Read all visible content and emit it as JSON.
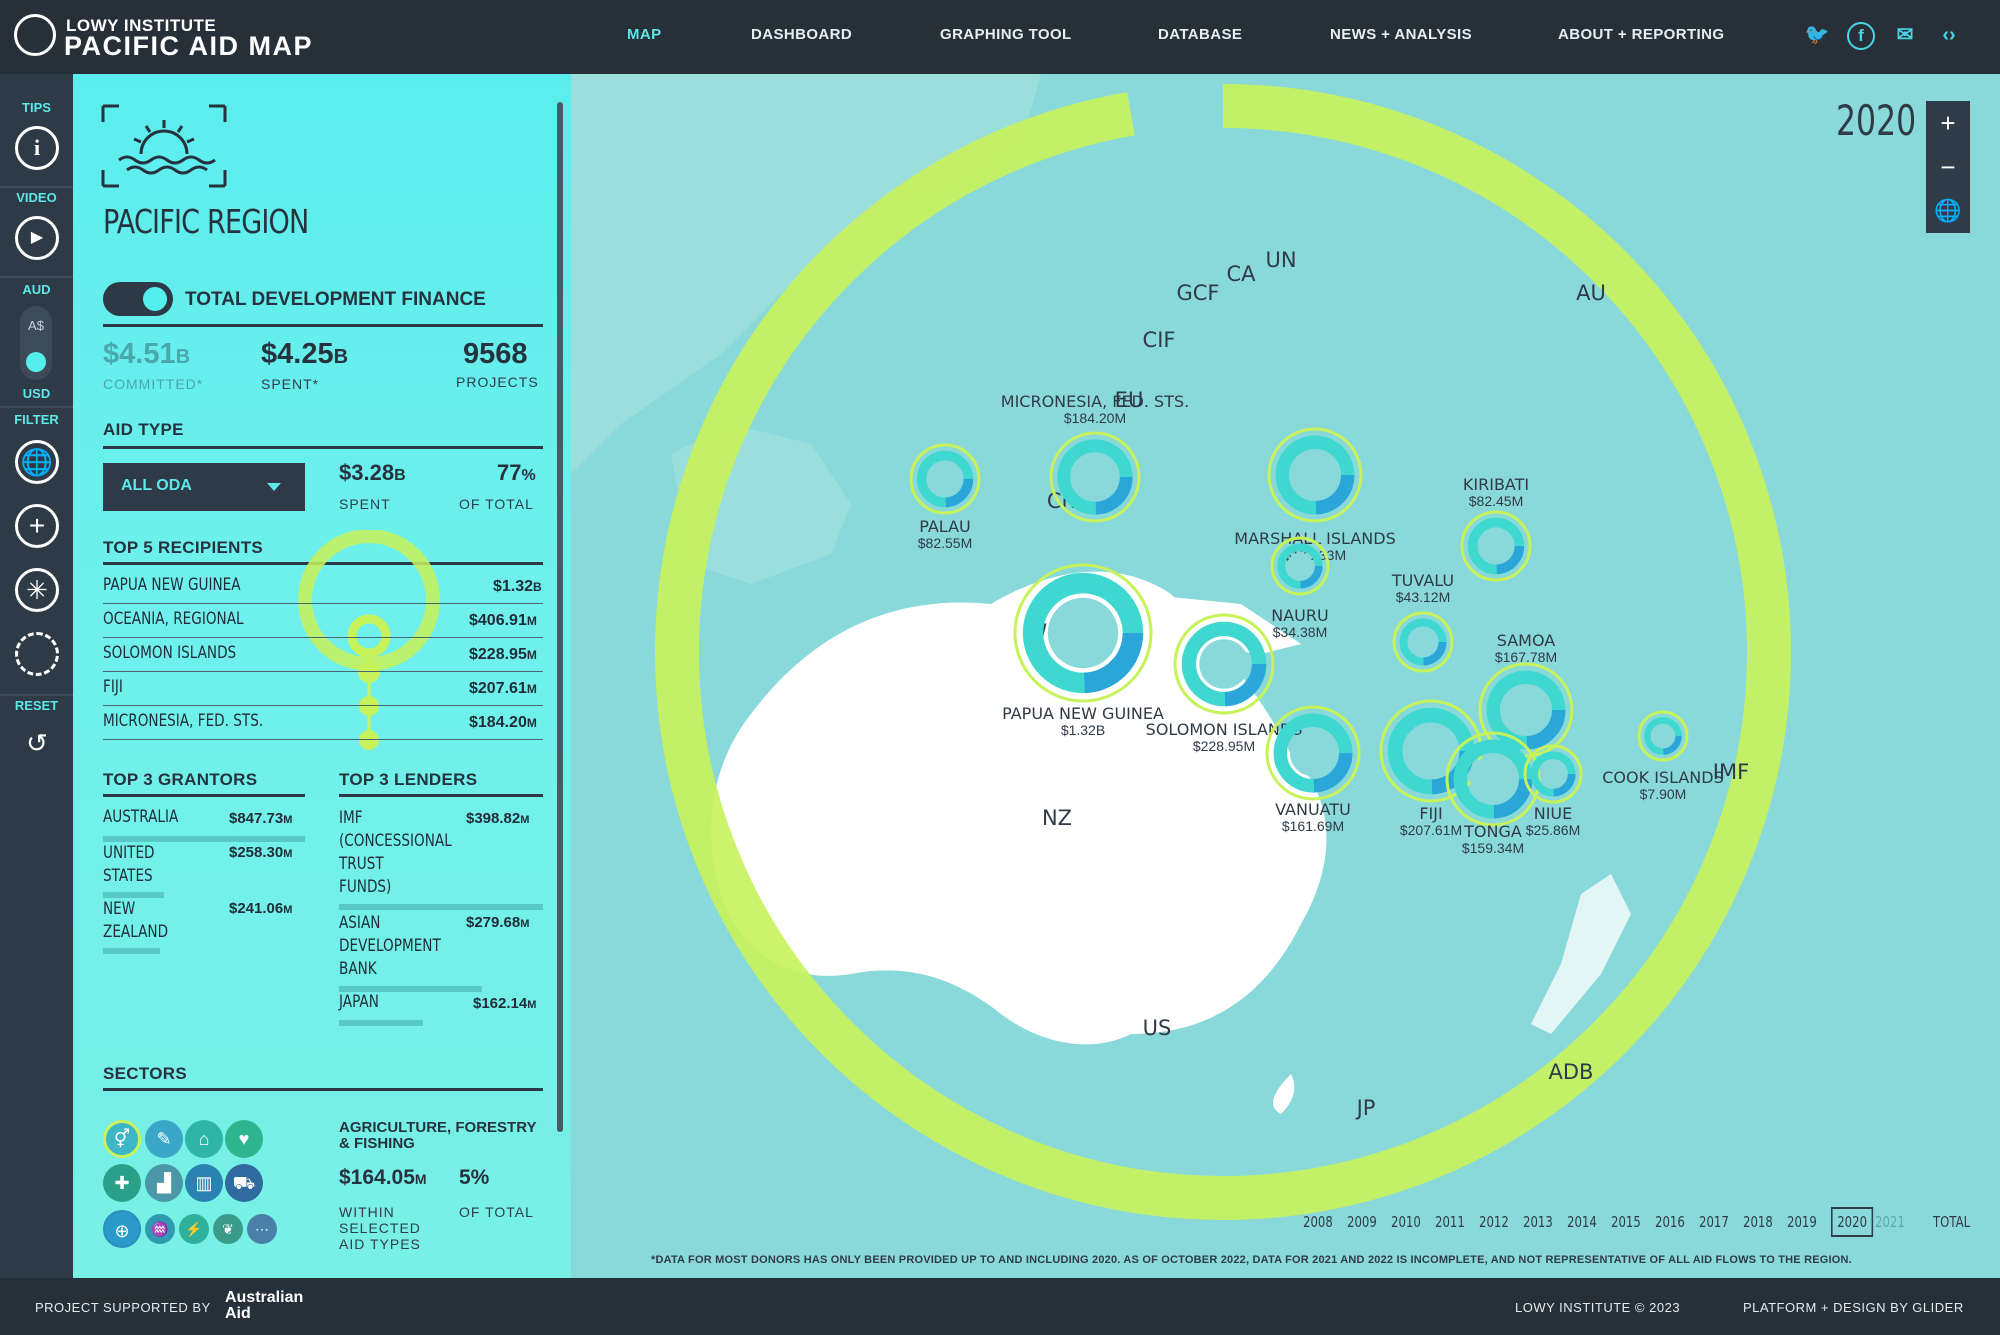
{
  "header": {
    "logo_sub": "LOWY INSTITUTE",
    "logo_title": "PACIFIC AID MAP",
    "nav": [
      "MAP",
      "DASHBOARD",
      "GRAPHING TOOL",
      "DATABASE",
      "NEWS + ANALYSIS",
      "ABOUT + REPORTING"
    ],
    "active_nav": "MAP",
    "social": [
      "twitter-icon",
      "facebook-icon",
      "mail-icon",
      "embed-code-icon"
    ]
  },
  "rail": {
    "tips": "TIPS",
    "video": "VIDEO",
    "aud": "AUD",
    "currency_symbol": "A$",
    "usd": "USD",
    "filter": "FILTER",
    "reset": "RESET"
  },
  "panel": {
    "region": "PACIFIC REGION",
    "toggle_label": "TOTAL DEVELOPMENT FINANCE",
    "committed_value": "$4.51",
    "committed_unit": "B",
    "committed_label": "COMMITTED*",
    "spent_value": "$4.25",
    "spent_unit": "B",
    "spent_label": "SPENT*",
    "projects_value": "9568",
    "projects_label": "PROJECTS",
    "aid_type_heading": "AID TYPE",
    "aid_type_selected": "ALL ODA",
    "aid_spent_value": "$3.28",
    "aid_spent_unit": "B",
    "aid_spent_label": "SPENT",
    "aid_pct_value": "77",
    "aid_pct_unit": "%",
    "aid_pct_label": "OF TOTAL",
    "top5_heading": "TOP 5 RECIPIENTS",
    "top5": [
      {
        "name": "PAPUA NEW GUINEA",
        "value": "$1.32",
        "unit": "B"
      },
      {
        "name": "OCEANIA, REGIONAL",
        "value": "$406.91",
        "unit": "M"
      },
      {
        "name": "SOLOMON ISLANDS",
        "value": "$228.95",
        "unit": "M"
      },
      {
        "name": "FIJI",
        "value": "$207.61",
        "unit": "M"
      },
      {
        "name": "MICRONESIA, FED. STS.",
        "value": "$184.20",
        "unit": "M"
      }
    ],
    "grantors_heading": "TOP 3 GRANTORS",
    "grantors": [
      {
        "name": "AUSTRALIA",
        "value": "$847.73",
        "unit": "M",
        "share": 1.0
      },
      {
        "name": "UNITED STATES",
        "value": "$258.30",
        "unit": "M",
        "share": 0.3
      },
      {
        "name": "NEW ZEALAND",
        "value": "$241.06",
        "unit": "M",
        "share": 0.28
      }
    ],
    "lenders_heading": "TOP 3 LENDERS",
    "lenders": [
      {
        "name": "IMF (CONCESSIONAL TRUST FUNDS)",
        "value": "$398.82",
        "unit": "M",
        "share": 1.0
      },
      {
        "name": "ASIAN DEVELOPMENT BANK",
        "value": "$279.68",
        "unit": "M",
        "share": 0.7
      },
      {
        "name": "JAPAN",
        "value": "$162.14",
        "unit": "M",
        "share": 0.41
      }
    ],
    "sectors_heading": "SECTORS",
    "sector_name": "AGRICULTURE, FORESTRY & FISHING",
    "sector_value": "$164.05",
    "sector_unit": "M",
    "sector_pct": "5%",
    "sector_within": "WITHIN SELECTED AID TYPES",
    "sector_of_total": "OF TOTAL"
  },
  "map": {
    "year": "2020",
    "donors": [
      "AU",
      "IMF",
      "ADB",
      "JP",
      "US",
      "NZ",
      "WB",
      "CN",
      "EU",
      "CIF",
      "GCF",
      "CA",
      "UN"
    ],
    "recipients": [
      {
        "name": "MICRONESIA, FED. STS.",
        "value": "$184.20M"
      },
      {
        "name": "PALAU",
        "value": "$82.55M"
      },
      {
        "name": "MARSHALL ISLANDS",
        "value": "$173.33M"
      },
      {
        "name": "KIRIBATI",
        "value": "$82.45M"
      },
      {
        "name": "NAURU",
        "value": "$34.38M"
      },
      {
        "name": "TUVALU",
        "value": "$43.12M"
      },
      {
        "name": "PAPUA NEW GUINEA",
        "value": "$1.32B"
      },
      {
        "name": "SOLOMON ISLANDS",
        "value": "$228.95M"
      },
      {
        "name": "SAMOA",
        "value": "$167.78M"
      },
      {
        "name": "VANUATU",
        "value": "$161.69M"
      },
      {
        "name": "FIJI",
        "value": "$207.61M"
      },
      {
        "name": "TONGA",
        "value": "$159.34M"
      },
      {
        "name": "NIUE",
        "value": "$25.86M"
      },
      {
        "name": "COOK ISLANDS",
        "value": "$7.90M"
      }
    ],
    "years": [
      "2008",
      "2009",
      "2010",
      "2011",
      "2012",
      "2013",
      "2014",
      "2015",
      "2016",
      "2017",
      "2018",
      "2019",
      "2020",
      "2021",
      "TOTAL"
    ],
    "selected_year": "2020",
    "footnote": "*DATA FOR MOST DONORS HAS ONLY BEEN PROVIDED UP TO AND INCLUDING 2020. AS OF OCTOBER 2022, DATA FOR 2021 AND 2022 IS INCOMPLETE, AND NOT REPRESENTATIVE OF ALL AID FLOWS TO THE REGION.",
    "zoom_in": "+",
    "zoom_out": "−"
  },
  "footer": {
    "supported": "PROJECT SUPPORTED BY",
    "partner": "Australian Aid",
    "copyright": "LOWY INSTITUTE © 2023",
    "credit": "PLATFORM + DESIGN BY GLIDER"
  },
  "colors": {
    "accent": "#5ce8e8",
    "ring": "#c8f25a",
    "navy": "#273039"
  }
}
